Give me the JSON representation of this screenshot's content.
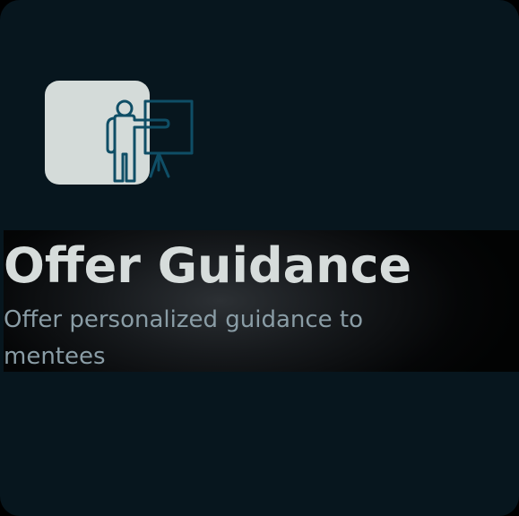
{
  "card": {
    "title": "Offer Guidance",
    "description": "Offer personalized guidance to mentees",
    "icon": "presenter-at-board-icon"
  },
  "colors": {
    "card_background": "#07161e",
    "icon_tile": "#d4dbd9",
    "icon_stroke": "#0f4e66",
    "title_text": "#d6dcdb",
    "description_text": "#8a9da6"
  }
}
